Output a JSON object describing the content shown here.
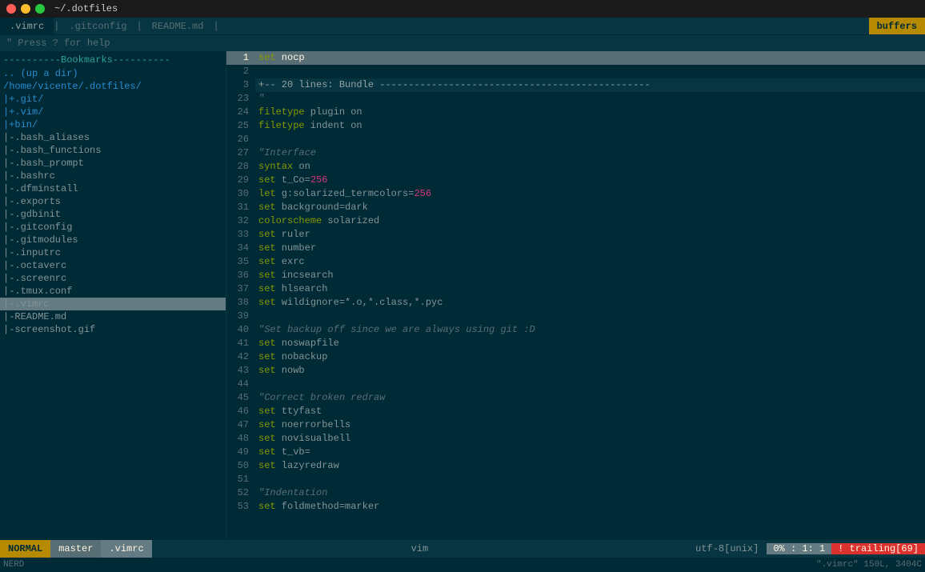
{
  "titlebar": {
    "title": "~/.dotfiles"
  },
  "tabs": [
    {
      "label": ".vimrc",
      "active": true
    },
    {
      "label": ".gitconfig",
      "active": false
    },
    {
      "label": "README.md",
      "active": false
    }
  ],
  "buffers_btn": "buffers",
  "helpline": {
    "text": "\" Press ? for help"
  },
  "sidebar": {
    "bookmarks_label": "----------Bookmarks----------",
    "items": [
      {
        "label": ".. (up a dir)",
        "type": "dir"
      },
      {
        "label": "/home/vicente/.dotfiles/",
        "type": "dir"
      },
      {
        "label": "|+.git/",
        "type": "dir"
      },
      {
        "label": "|+.vim/",
        "type": "dir"
      },
      {
        "label": "|+bin/",
        "type": "dir"
      },
      {
        "label": "|-.bash_aliases",
        "type": "file"
      },
      {
        "label": "|-.bash_functions",
        "type": "file"
      },
      {
        "label": "|-.bash_prompt",
        "type": "file"
      },
      {
        "label": "|-.bashrc",
        "type": "file"
      },
      {
        "label": "|-.dfminstall",
        "type": "file"
      },
      {
        "label": "|-.exports",
        "type": "file"
      },
      {
        "label": "|-.gdbinit",
        "type": "file"
      },
      {
        "label": "|-.gitconfig",
        "type": "file"
      },
      {
        "label": "|-.gitmodules",
        "type": "file"
      },
      {
        "label": "|-.inputrc",
        "type": "file"
      },
      {
        "label": "|-.octaverc",
        "type": "file"
      },
      {
        "label": "|-.screenrc",
        "type": "file"
      },
      {
        "label": "|-.tmux.conf",
        "type": "file"
      },
      {
        "label": "|-  .vimrc",
        "type": "file",
        "active": true
      },
      {
        "label": "|-README.md",
        "type": "file"
      },
      {
        "label": "|-screenshot.gif",
        "type": "file"
      }
    ]
  },
  "editor": {
    "lines": [
      {
        "num": 1,
        "content": "set nocp",
        "selected": true
      },
      {
        "num": 2,
        "content": ""
      },
      {
        "num": 3,
        "content": "+-- 20 lines: Bundle -----------------------------------------------",
        "fold": true
      },
      {
        "num": 23,
        "content": "\""
      },
      {
        "num": 24,
        "content": "filetype plugin on"
      },
      {
        "num": 25,
        "content": "filetype indent on"
      },
      {
        "num": 26,
        "content": ""
      },
      {
        "num": 27,
        "content": "\"Interface"
      },
      {
        "num": 28,
        "content": "syntax on"
      },
      {
        "num": 29,
        "content": "set t_Co=256"
      },
      {
        "num": 30,
        "content": "let g:solarized_termcolors=256"
      },
      {
        "num": 31,
        "content": "set background=dark"
      },
      {
        "num": 32,
        "content": "colorscheme solarized"
      },
      {
        "num": 33,
        "content": "set ruler"
      },
      {
        "num": 34,
        "content": "set number"
      },
      {
        "num": 35,
        "content": "set exrc"
      },
      {
        "num": 36,
        "content": "set incsearch"
      },
      {
        "num": 37,
        "content": "set hlsearch"
      },
      {
        "num": 38,
        "content": "set wildignore=*.o,*.class,*.pyc"
      },
      {
        "num": 39,
        "content": ""
      },
      {
        "num": 40,
        "content": "\"Set backup off since we are always using git :D"
      },
      {
        "num": 41,
        "content": "set noswapfile"
      },
      {
        "num": 42,
        "content": "set nobackup"
      },
      {
        "num": 43,
        "content": "set nowb"
      },
      {
        "num": 44,
        "content": ""
      },
      {
        "num": 45,
        "content": "\"Correct broken redraw"
      },
      {
        "num": 46,
        "content": "set ttyfast"
      },
      {
        "num": 47,
        "content": "set noerrorbells"
      },
      {
        "num": 48,
        "content": "set novisualbell"
      },
      {
        "num": 49,
        "content": "set t_vb="
      },
      {
        "num": 50,
        "content": "set lazyredraw"
      },
      {
        "num": 51,
        "content": ""
      },
      {
        "num": 52,
        "content": "\"Indentation"
      },
      {
        "num": 53,
        "content": "set foldmethod=marker"
      }
    ]
  },
  "statusbar": {
    "mode": "NORMAL",
    "branch": "master",
    "filename": ".vimrc",
    "filetype": "vim",
    "encoding": "utf-8[unix]",
    "percent": "0%",
    "line": "1",
    "col": "1",
    "trailing": "! trailing[69]"
  },
  "bottombar": {
    "left": "NERD",
    "right": "\".vimrc\" 150L, 3404C"
  }
}
